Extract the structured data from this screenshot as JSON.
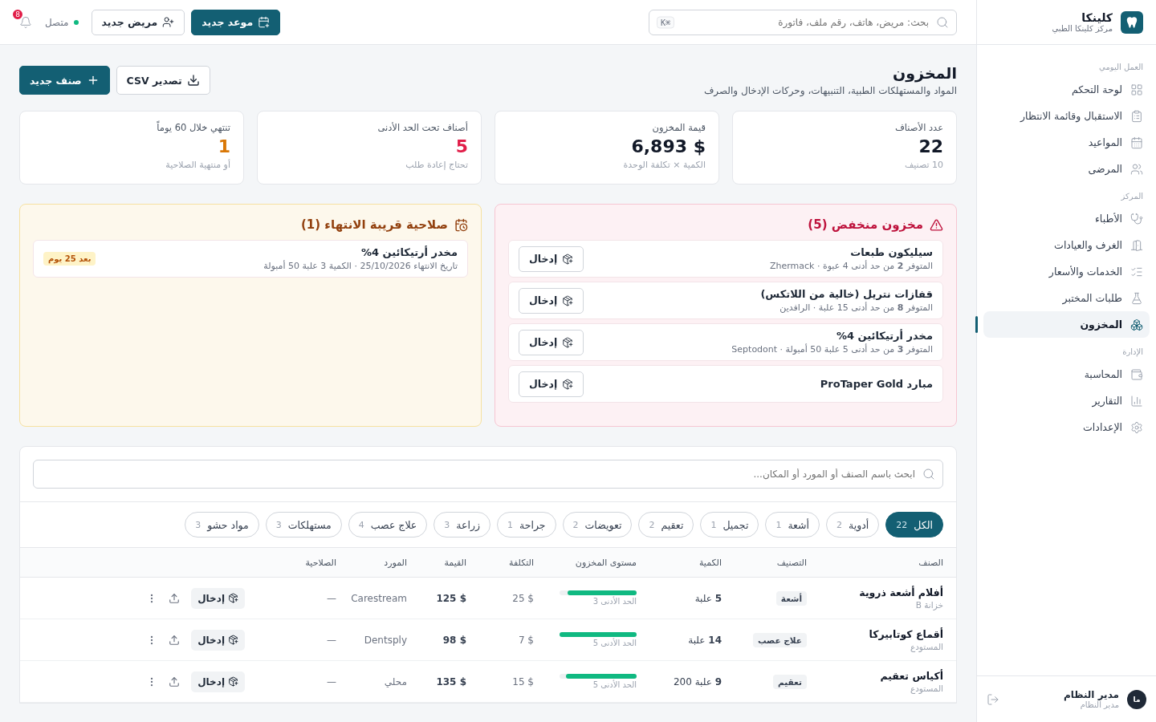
{
  "brand": {
    "name": "كلينكا",
    "subtitle": "مركز كلينكا الطبي"
  },
  "sidebar": {
    "sections": [
      {
        "title": "العمل اليومي",
        "items": [
          {
            "label": "لوحة التحكم",
            "kind": "dashboard",
            "selected": false
          },
          {
            "label": "الاستقبال وقائمة الانتظار",
            "kind": "reception",
            "selected": false
          },
          {
            "label": "المواعيد",
            "kind": "calendar",
            "selected": false
          },
          {
            "label": "المرضى",
            "kind": "patients",
            "selected": false
          }
        ]
      },
      {
        "title": "المركز",
        "items": [
          {
            "label": "الأطباء",
            "kind": "doctors",
            "selected": false
          },
          {
            "label": "الغرف والعيادات",
            "kind": "rooms",
            "selected": false
          },
          {
            "label": "الخدمات والأسعار",
            "kind": "services",
            "selected": false
          },
          {
            "label": "طلبات المختبر",
            "kind": "lab",
            "selected": false
          },
          {
            "label": "المخزون",
            "kind": "inventory",
            "selected": true
          }
        ]
      },
      {
        "title": "الإدارة",
        "items": [
          {
            "label": "المحاسبة",
            "kind": "accounting",
            "selected": false
          },
          {
            "label": "التقارير",
            "kind": "reports",
            "selected": false
          },
          {
            "label": "الإعدادات",
            "kind": "settings",
            "selected": false
          }
        ]
      }
    ],
    "user": {
      "initials": "ما",
      "name": "مدير النظام",
      "role": "مدير النظام"
    }
  },
  "topbar": {
    "search": {
      "placeholder": "بحث: مريض، هاتف، رقم ملف، فاتورة",
      "shortcut": "⌘K"
    },
    "buttons": [
      {
        "label": "موعد جديد",
        "kind": "appointment"
      },
      {
        "label": "مريض جديد",
        "kind": "patient"
      }
    ],
    "status": {
      "label": "متصل",
      "online": true
    },
    "notifications": "8"
  },
  "page": {
    "title": "المخزون",
    "subtitle": "المواد والمستهلكات الطبية، التنبيهات، وحركات الإدخال والصرف",
    "buttons": [
      {
        "label": "تصدير CSV",
        "kind": "export"
      },
      {
        "label": "صنف جديد",
        "kind": "add"
      }
    ]
  },
  "stats": [
    {
      "label": "عدد الأصناف",
      "value": "22",
      "note": "10 تصنيف",
      "color": "#111827"
    },
    {
      "label": "قيمة المخزون",
      "value": "$ 6,893",
      "note": "الكمية × تكلفة الوحدة",
      "color": "#111827"
    },
    {
      "label": "أصناف تحت الحد الأدنى",
      "value": "5",
      "note": "تحتاج إعادة طلب",
      "color": "#e11d48"
    },
    {
      "label": "تنتهي خلال 60 يوماً",
      "value": "1",
      "note": "أو منتهية الصلاحية",
      "color": "#d97706"
    }
  ],
  "low_stock": {
    "title": "مخزون منخفض (5)",
    "items": [
      {
        "name": "سيليكون طبعات",
        "detail": "المتوفر **2** من حد أدنى 4 عبوة · Zhermack",
        "action": "إدخال"
      },
      {
        "name": "قفازات نتريل (خالية من اللاتكس)",
        "detail": "المتوفر **8** من حد أدنى 15 علبة · الرافدين",
        "action": "إدخال"
      },
      {
        "name": "مخدر أرتيكائين 4%",
        "detail": "المتوفر **3** من حد أدنى 5 علبة 50 أمبولة · Septodont",
        "action": "إدخال"
      },
      {
        "name": "مبارد ProTaper Gold",
        "action": "إدخال"
      }
    ]
  },
  "expiring": {
    "title": "صلاحية قريبة الانتهاء (1)",
    "items": [
      {
        "name": "مخدر أرتيكائين 4%",
        "detail": "تاريخ الانتهاء 25/10/2026 · الكمية 3 علبة 50 أمبولة",
        "badge": "بعد 25 يوم"
      }
    ]
  },
  "inventory": {
    "search": {
      "placeholder": "ابحث باسم الصنف أو المورد أو المكان..."
    },
    "filters": [
      {
        "label": "الكل",
        "count": "22",
        "selected": true
      },
      {
        "label": "أدوية",
        "count": "2",
        "selected": false
      },
      {
        "label": "أشعة",
        "count": "1",
        "selected": false
      },
      {
        "label": "تجميل",
        "count": "1",
        "selected": false
      },
      {
        "label": "تعقيم",
        "count": "2",
        "selected": false
      },
      {
        "label": "تعويضات",
        "count": "2",
        "selected": false
      },
      {
        "label": "جراحة",
        "count": "1",
        "selected": false
      },
      {
        "label": "زراعة",
        "count": "3",
        "selected": false
      },
      {
        "label": "علاج عصب",
        "count": "4",
        "selected": false
      },
      {
        "label": "مستهلكات",
        "count": "3",
        "selected": false
      },
      {
        "label": "مواد حشو",
        "count": "3",
        "selected": false
      }
    ],
    "columns": [
      "الصنف",
      "التصنيف",
      "الكمية",
      "مستوى المخزون",
      "التكلفة",
      "القيمة",
      "المورد",
      "الصلاحية"
    ],
    "rows": [
      {
        "name": "أفلام أشعة ذروية",
        "location": "خزانة B",
        "category": "أشعة",
        "quantity": "**5** علبة",
        "level": 0.9,
        "minimum": "الحد الأدنى 3",
        "cost": "$ 25",
        "value": "$ 125",
        "supplier": "Carestream",
        "expiry": "—",
        "action": "إدخال"
      },
      {
        "name": "أقماع كوتابيركا",
        "location": "المستودع",
        "category": "علاج عصب",
        "quantity": "**14** علبة",
        "level": 1,
        "minimum": "الحد الأدنى 5",
        "cost": "$ 7",
        "value": "$ 98",
        "supplier": "Dentsply",
        "expiry": "—",
        "action": "إدخال"
      },
      {
        "name": "أكياس تعقيم",
        "location": "المستودع",
        "category": "تعقيم",
        "quantity": "**9** علبة 200",
        "level": 0.92,
        "minimum": "الحد الأدنى 5",
        "cost": "$ 15",
        "value": "$ 135",
        "supplier": "محلي",
        "expiry": "—",
        "action": "إدخال"
      }
    ]
  }
}
